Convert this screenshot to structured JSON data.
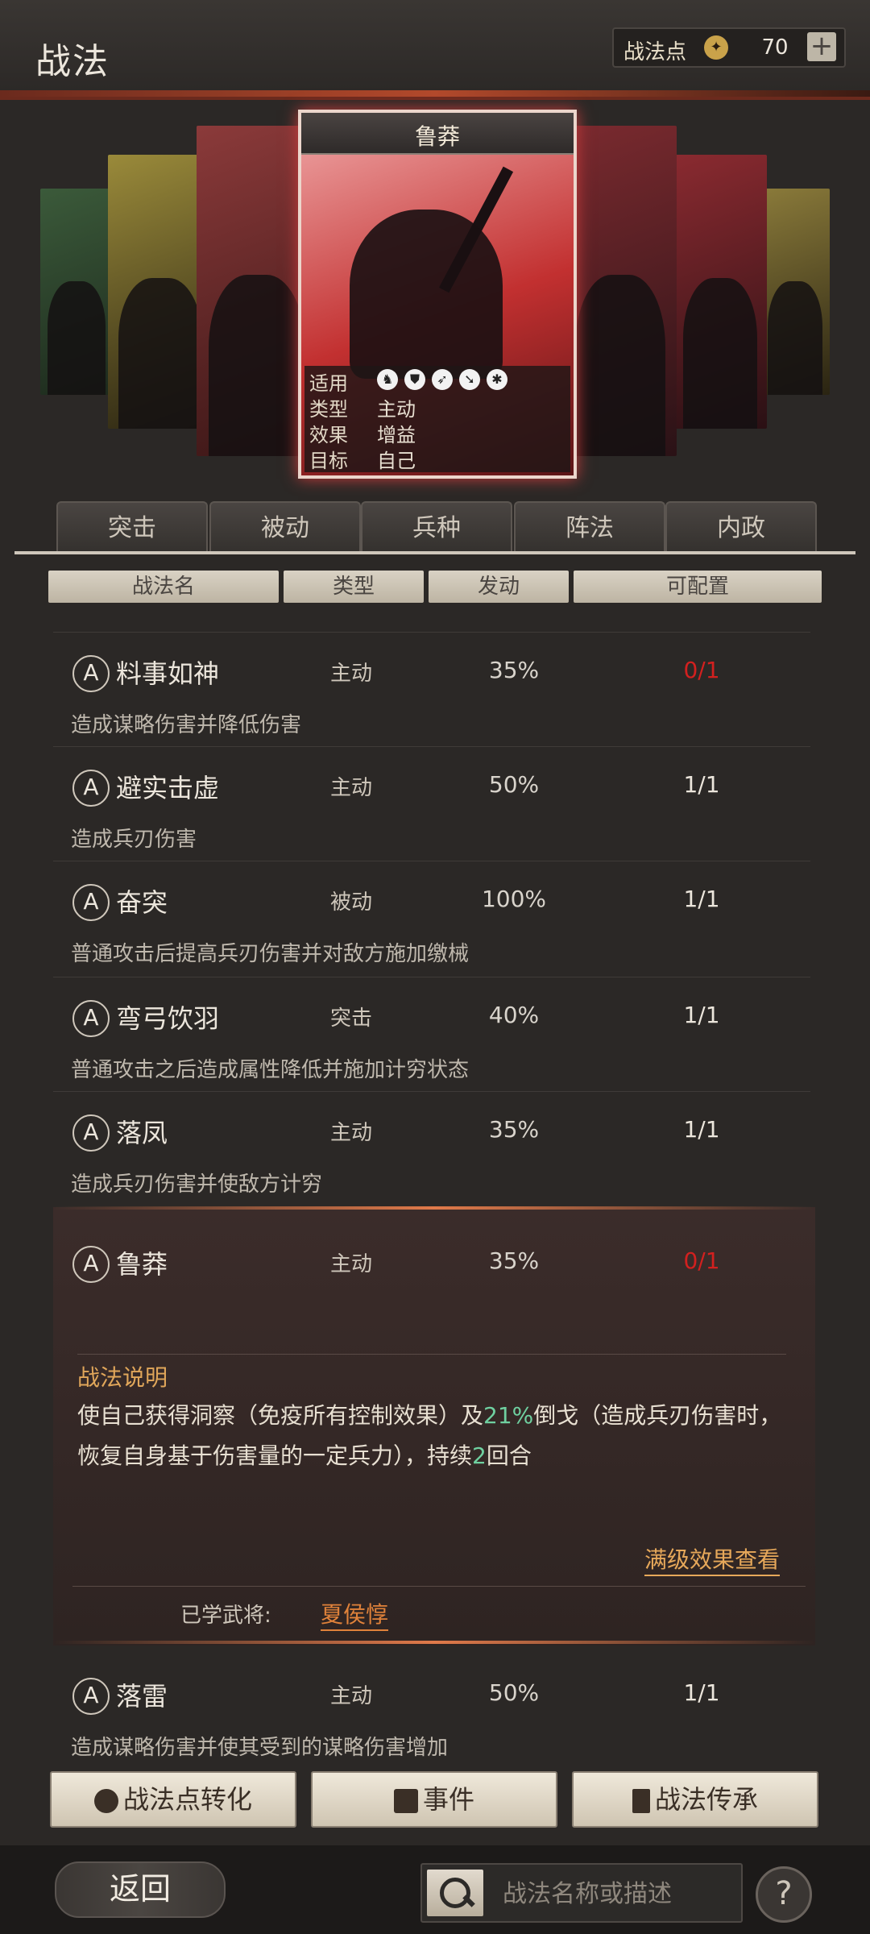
{
  "header": {
    "title": "战法",
    "points_label": "战法点",
    "points_icon": "compass-coin-icon",
    "points_value": "70",
    "plus_label": "+"
  },
  "featured_card": {
    "name": "鲁莽",
    "rows": [
      {
        "key": "适用",
        "icons": [
          "cavalry-icon",
          "shield-icon",
          "bow-icon",
          "spear-icon",
          "wheel-icon"
        ]
      },
      {
        "key": "类型",
        "value": "主动"
      },
      {
        "key": "效果",
        "value": "增益"
      },
      {
        "key": "目标",
        "value": "自己"
      }
    ]
  },
  "tabs": [
    "突击",
    "被动",
    "兵种",
    "阵法",
    "内政"
  ],
  "columns": [
    "战法名",
    "类型",
    "发动",
    "可配置"
  ],
  "rows": [
    {
      "badge": "A",
      "name": "料事如神",
      "type": "主动",
      "rate": "35%",
      "slot": "0/1",
      "slot_red": true,
      "desc": "造成谋略伤害并降低伤害"
    },
    {
      "badge": "A",
      "name": "避实击虚",
      "type": "主动",
      "rate": "50%",
      "slot": "1/1",
      "slot_red": false,
      "desc": "造成兵刃伤害"
    },
    {
      "badge": "A",
      "name": "奋突",
      "type": "被动",
      "rate": "100%",
      "slot": "1/1",
      "slot_red": false,
      "desc": "普通攻击后提高兵刃伤害并对敌方施加缴械"
    },
    {
      "badge": "A",
      "name": "弯弓饮羽",
      "type": "突击",
      "rate": "40%",
      "slot": "1/1",
      "slot_red": false,
      "desc": "普通攻击之后造成属性降低并施加计穷状态"
    },
    {
      "badge": "A",
      "name": "落凤",
      "type": "主动",
      "rate": "35%",
      "slot": "1/1",
      "slot_red": false,
      "desc": "造成兵刃伤害并使敌方计穷"
    }
  ],
  "expanded": {
    "badge": "A",
    "name": "鲁莽",
    "type": "主动",
    "rate": "35%",
    "slot": "0/1",
    "section_title": "战法说明",
    "desc_part1": "使自己获得洞察（免疫所有控制效果）及",
    "desc_pct": "21%",
    "desc_part2": "倒戈（造成兵刃伤害时，恢复自身基于伤害量的一定兵力），持续",
    "desc_turns": "2",
    "desc_part3": "回合",
    "full_effect_link": "满级效果查看",
    "learned_label": "已学武将:",
    "learned_general": "夏侯惇"
  },
  "last_row": {
    "badge": "A",
    "name": "落雷",
    "type": "主动",
    "rate": "50%",
    "slot": "1/1",
    "desc": "造成谋略伤害并使其受到的谋略伤害增加"
  },
  "buttons": {
    "convert": "战法点转化",
    "event": "事件",
    "inherit": "战法传承"
  },
  "footer": {
    "back": "返回",
    "search_placeholder": "战法名称或描述",
    "help": "?"
  },
  "colors": {
    "accent": "#b24a2c",
    "red_slot": "#d2201f",
    "highlight": "#6fd0a0",
    "link": "#e6a85a"
  }
}
